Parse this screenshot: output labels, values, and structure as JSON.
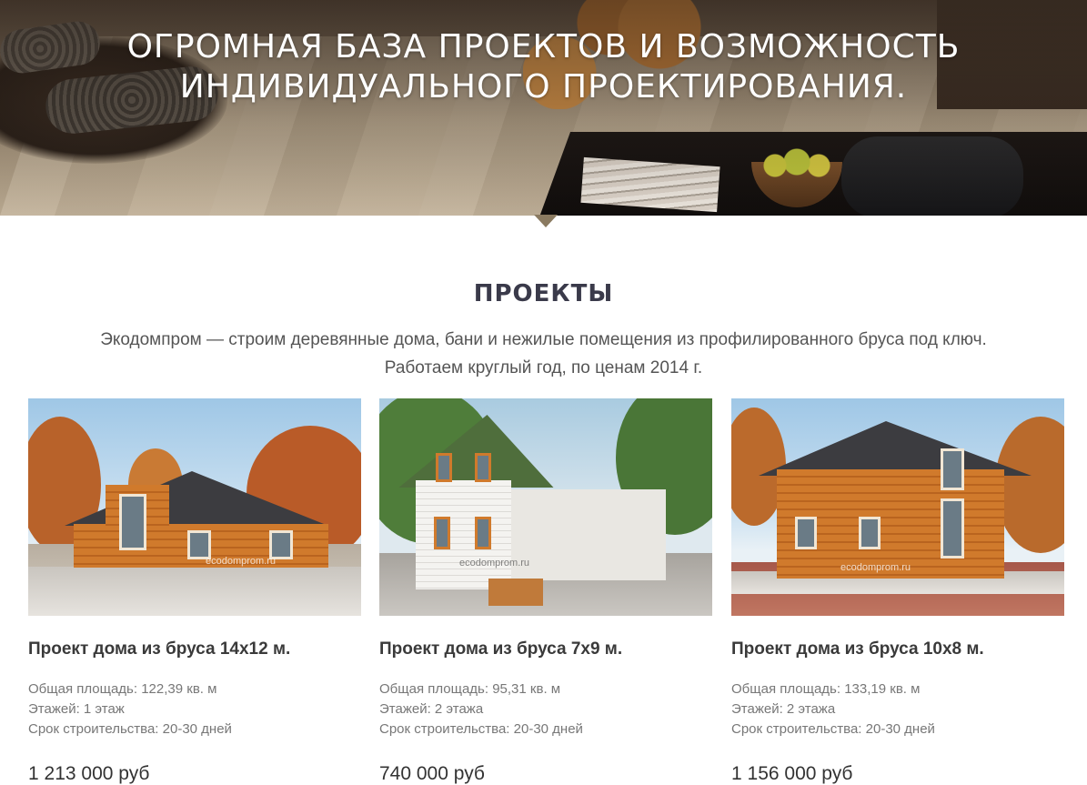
{
  "hero": {
    "title_line1": "ОГРОМНАЯ БАЗА ПРОЕКТОВ И ВОЗМОЖНОСТЬ",
    "title_line2": "ИНДИВИДУАЛЬНОГО ПРОЕКТИРОВАНИЯ."
  },
  "section": {
    "title": "ПРОЕКТЫ",
    "subtitle_line1": "Экодомпром — строим деревянные дома, бани и нежилые помещения из профилированного бруса под ключ.",
    "subtitle_line2": "Работаем круглый год, по ценам 2014 г."
  },
  "watermark": "ecodomprom.ru",
  "cards": [
    {
      "title": "Проект дома из бруса 14x12 м.",
      "area": "Общая площадь: 122,39 кв. м",
      "floors": "Этажей: 1 этаж",
      "term": "Срок строительства: 20-30 дней",
      "price": "1 213 000 руб"
    },
    {
      "title": "Проект дома из бруса 7x9 м.",
      "area": "Общая площадь: 95,31 кв. м",
      "floors": "Этажей: 2 этажа",
      "term": "Срок строительства: 20-30 дней",
      "price": "740 000 руб"
    },
    {
      "title": "Проект дома из бруса 10x8 м.",
      "area": "Общая площадь: 133,19 кв. м",
      "floors": "Этажей: 2 этажа",
      "term": "Срок строительства: 20-30 дней",
      "price": "1 156 000 руб"
    }
  ],
  "colors": {
    "hero_text": "#ffffff",
    "section_title": "#3a3a4a",
    "arrow": "#8a7a60",
    "wood": "#d07a2c",
    "roof_dark": "#3c3c40",
    "roof_green": "#4f6e3c"
  }
}
